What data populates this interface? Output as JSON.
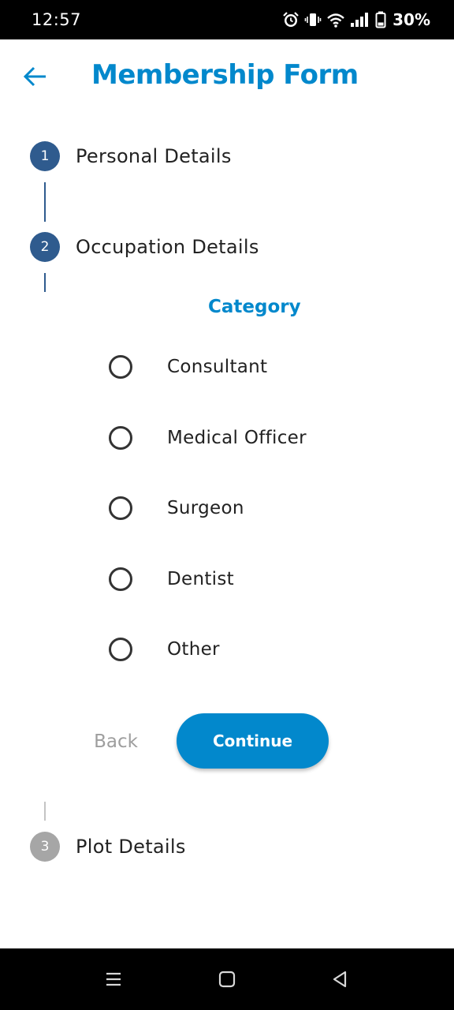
{
  "status_bar": {
    "time": "12:57",
    "battery": "30%",
    "icons": [
      "alarm-icon",
      "vibrate-icon",
      "wifi-icon",
      "signal-icon",
      "battery-icon"
    ]
  },
  "app_bar": {
    "title": "Membership Form",
    "back_icon": "arrow-left-icon"
  },
  "steps": [
    {
      "number": "1",
      "title": "Personal Details",
      "state": "complete"
    },
    {
      "number": "2",
      "title": "Occupation Details",
      "state": "active"
    },
    {
      "number": "3",
      "title": "Plot Details",
      "state": "inactive"
    }
  ],
  "occupation": {
    "category_label": "Category",
    "options": [
      "Consultant",
      "Medical Officer",
      "Surgeon",
      "Dentist",
      "Other"
    ],
    "selected": null
  },
  "actions": {
    "back_label": "Back",
    "continue_label": "Continue"
  },
  "colors": {
    "accent": "#0288cc",
    "step_active": "#2f5b8e",
    "step_inactive": "#a6a6a6"
  },
  "nav_bar": {
    "icons": [
      "menu-icon",
      "home-icon",
      "back-triangle-icon"
    ]
  }
}
